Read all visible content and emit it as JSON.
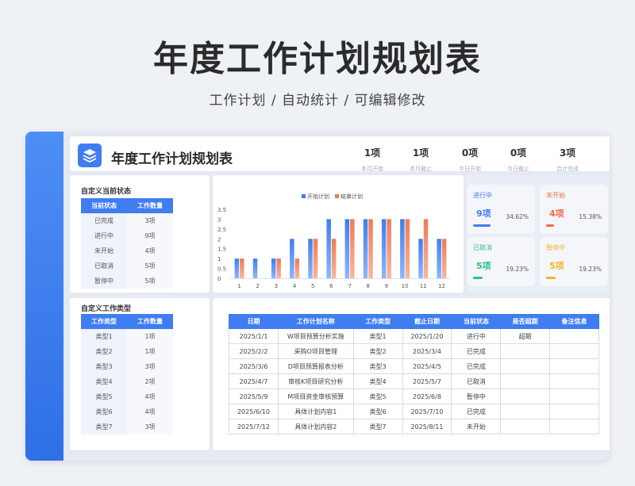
{
  "page": {
    "title": "年度工作计划规划表",
    "subtitle": "工作计划 /  自动统计  /  可编辑修改"
  },
  "header": {
    "title": "年度工作计划规划表",
    "kpis": [
      {
        "value": "1项",
        "label": "本月开始"
      },
      {
        "value": "1项",
        "label": "本月截止"
      },
      {
        "value": "0项",
        "label": "今日开始"
      },
      {
        "value": "0项",
        "label": "今日截止"
      },
      {
        "value": "3项",
        "label": "合计完成"
      }
    ]
  },
  "status_table": {
    "label": "自定义当前状态",
    "headers": [
      "当前状态",
      "工作数量"
    ],
    "rows": [
      [
        "已完成",
        "3项"
      ],
      [
        "进行中",
        "9项"
      ],
      [
        "未开始",
        "4项"
      ],
      [
        "已取消",
        "5项"
      ],
      [
        "暂停中",
        "5项"
      ]
    ]
  },
  "type_table": {
    "label": "自定义工作类型",
    "headers": [
      "工作类型",
      "工作数量"
    ],
    "rows": [
      [
        "类型1",
        "1项"
      ],
      [
        "类型2",
        "1项"
      ],
      [
        "类型3",
        "3项"
      ],
      [
        "类型4",
        "2项"
      ],
      [
        "类型5",
        "4项"
      ],
      [
        "类型6",
        "4项"
      ],
      [
        "类型7",
        "3项"
      ]
    ]
  },
  "chart_data": {
    "type": "bar",
    "categories": [
      "1",
      "2",
      "3",
      "4",
      "5",
      "6",
      "7",
      "8",
      "9",
      "10",
      "11",
      "12"
    ],
    "series": [
      {
        "name": "开始计划",
        "values": [
          1,
          1,
          1,
          2,
          2,
          3,
          3,
          3,
          3,
          3,
          2,
          2
        ]
      },
      {
        "name": "结束计划",
        "values": [
          1,
          0,
          1,
          1,
          2,
          2,
          3,
          3,
          3,
          3,
          3,
          2
        ]
      }
    ],
    "yticks": [
      "0",
      "0.5",
      "1",
      "1.5",
      "2",
      "2.5",
      "3",
      "3.5"
    ],
    "ylim": [
      0,
      3.5
    ],
    "legend_position": "top",
    "grid": false,
    "colors": {
      "开始计划": "#3f7df0",
      "结束计划": "#f07a55"
    }
  },
  "stats": [
    {
      "title": "进行中",
      "value": "9项",
      "percent": "34.62%",
      "color": "#3f7df0"
    },
    {
      "title": "未开始",
      "value": "4项",
      "percent": "15.38%",
      "color": "#f06a4a"
    },
    {
      "title": "已取消",
      "value": "5项",
      "percent": "19.23%",
      "color": "#2fbf8a"
    },
    {
      "title": "暂停中",
      "value": "5项",
      "percent": "19.23%",
      "color": "#f5b324"
    }
  ],
  "main_table": {
    "headers": [
      "日期",
      "工作计划名称",
      "工作类型",
      "截止日期",
      "当前状态",
      "是否超期",
      "备注信息"
    ],
    "rows": [
      [
        "2025/1/1",
        "W项目预算分析实施",
        "类型1",
        "2025/1/20",
        "进行中",
        "超期",
        ""
      ],
      [
        "2025/2/2",
        "采购O项目管理",
        "类型2",
        "2025/3/4",
        "已完成",
        "",
        ""
      ],
      [
        "2025/3/6",
        "D项目预算报表分析",
        "类型3",
        "2025/4/5",
        "已完成",
        "",
        ""
      ],
      [
        "2025/4/7",
        "审核K项目研究分析",
        "类型4",
        "2025/5/7",
        "已取消",
        "",
        ""
      ],
      [
        "2025/5/9",
        "M项目资金审核预算",
        "类型5",
        "2025/6/8",
        "暂停中",
        "",
        ""
      ],
      [
        "2025/6/10",
        "具体计划内容1",
        "类型6",
        "2025/7/10",
        "已完成",
        "",
        ""
      ],
      [
        "2025/7/12",
        "具体计划内容2",
        "类型7",
        "2025/8/11",
        "未开始",
        "",
        ""
      ]
    ]
  }
}
